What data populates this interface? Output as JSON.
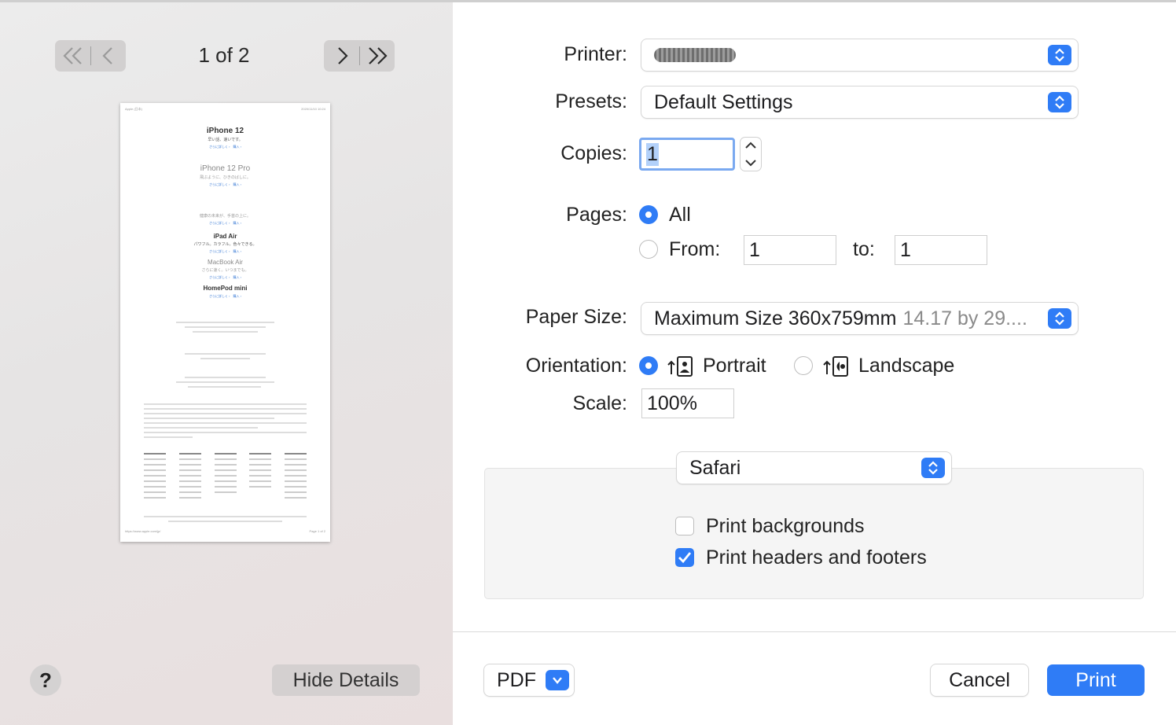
{
  "preview": {
    "page_counter": "1 of 2",
    "nav_first_prev": "first-previous-page",
    "nav_next_last": "next-last-page",
    "doc": {
      "header_left": "Apple (日本)",
      "header_right": "2020/11/10 10:24",
      "sections": [
        {
          "title": "iPhone 12",
          "sub": "早い話、速いです。",
          "links": "さらに詳しく ›　購入 ›"
        },
        {
          "title": "iPhone 12 Pro",
          "sub": "飛ぶように、ひきのばしに。",
          "links": "さらに詳しく ›　購入 ›"
        },
        {
          "title": "",
          "sub": "健康の未来が、手首の上に。",
          "links": "さらに詳しく ›　購入 ›"
        },
        {
          "title": "iPad Air",
          "sub": "パワフル。カラフル。色々できる。",
          "links": "さらに詳しく ›　購入 ›"
        },
        {
          "title": "MacBook Air",
          "sub": "さらに速く。いつまでも。",
          "links": "さらに詳しく ›　購入 ›"
        },
        {
          "title": "HomePod mini",
          "sub": "",
          "links": "さらに詳しく ›　購入 ›"
        }
      ],
      "footer_left": "https://www.apple.com/jp/",
      "footer_right": "Page 1 of 2"
    }
  },
  "help_label": "?",
  "hide_details_label": "Hide Details",
  "settings": {
    "printer_label": "Printer:",
    "presets_label": "Presets:",
    "presets_value": "Default Settings",
    "copies_label": "Copies:",
    "copies_value": "1",
    "pages_label": "Pages:",
    "pages_all": "All",
    "pages_from_label": "From:",
    "pages_from_value": "1",
    "pages_to_label": "to:",
    "pages_to_value": "1",
    "paper_size_label": "Paper Size:",
    "paper_size_value": "Maximum Size 360x759mm",
    "paper_size_dims": "14.17 by 29....",
    "orientation_label": "Orientation:",
    "orientation_portrait": "Portrait",
    "orientation_landscape": "Landscape",
    "scale_label": "Scale:",
    "scale_value": "100%",
    "app_section_value": "Safari",
    "print_backgrounds": "Print backgrounds",
    "print_headers_footers": "Print headers and footers"
  },
  "footer": {
    "pdf_label": "PDF",
    "cancel_label": "Cancel",
    "print_label": "Print"
  },
  "colors": {
    "accent": "#2f7cf6"
  }
}
